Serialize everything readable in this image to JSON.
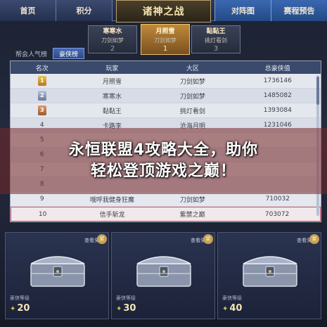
{
  "nav": {
    "home": "首页",
    "points": "积分",
    "title": "诸神之战",
    "matchups": "对阵图",
    "preview": "赛程预告"
  },
  "podium": {
    "first": {
      "name": "月照雪",
      "server": "刀剑如梦",
      "rank": "1"
    },
    "second": {
      "name": "寒寒水",
      "server": "刀剑如梦",
      "rank": "2"
    },
    "third": {
      "name": "黏黏王",
      "server": "挑灯看剑",
      "rank": "3"
    }
  },
  "tabs": [
    {
      "label": "帮会人气榜"
    },
    {
      "label": "豪侠榜"
    }
  ],
  "table": {
    "headers": [
      "名次",
      "玩家",
      "大区",
      "总豪侠值"
    ],
    "rows": [
      {
        "rank": "1",
        "player": "月照雪",
        "server": "刀剑如梦",
        "value": "1736146"
      },
      {
        "rank": "2",
        "player": "寒寒水",
        "server": "刀剑如梦",
        "value": "1485082"
      },
      {
        "rank": "3",
        "player": "黏黏王",
        "server": "挑灯看剑",
        "value": "1393084"
      },
      {
        "rank": "4",
        "player": "卡路李",
        "server": "沧海月明",
        "value": "1231046"
      },
      {
        "rank": "5",
        "player": "",
        "server": "",
        "value": ""
      },
      {
        "rank": "6",
        "player": "",
        "server": "",
        "value": ""
      },
      {
        "rank": "7",
        "player": "",
        "server": "",
        "value": ""
      },
      {
        "rank": "8",
        "player": "",
        "server": "",
        "value": ""
      },
      {
        "rank": "9",
        "player": "哦呼我健身狂魔",
        "server": "刀剑如梦",
        "value": "710032"
      },
      {
        "rank": "10",
        "player": "信手斩龙",
        "server": "紫禁之巅",
        "value": "703072"
      }
    ]
  },
  "banner": {
    "line1": "永恒联盟4攻略大全，助你",
    "line2": "轻松登顶游戏之巅！"
  },
  "chests": [
    {
      "view": "查看奖池",
      "label": "豪侠等级",
      "level": "20",
      "badge": "奖"
    },
    {
      "view": "查看奖池",
      "label": "豪侠等级",
      "level": "30",
      "badge": "奖"
    },
    {
      "view": "查看奖池",
      "label": "豪侠等级",
      "level": "40",
      "badge": "奖"
    }
  ],
  "colors": {
    "nav_active": "#3a68b0",
    "gold": "#c08a3a",
    "highlight_row": "#d05a6a"
  }
}
